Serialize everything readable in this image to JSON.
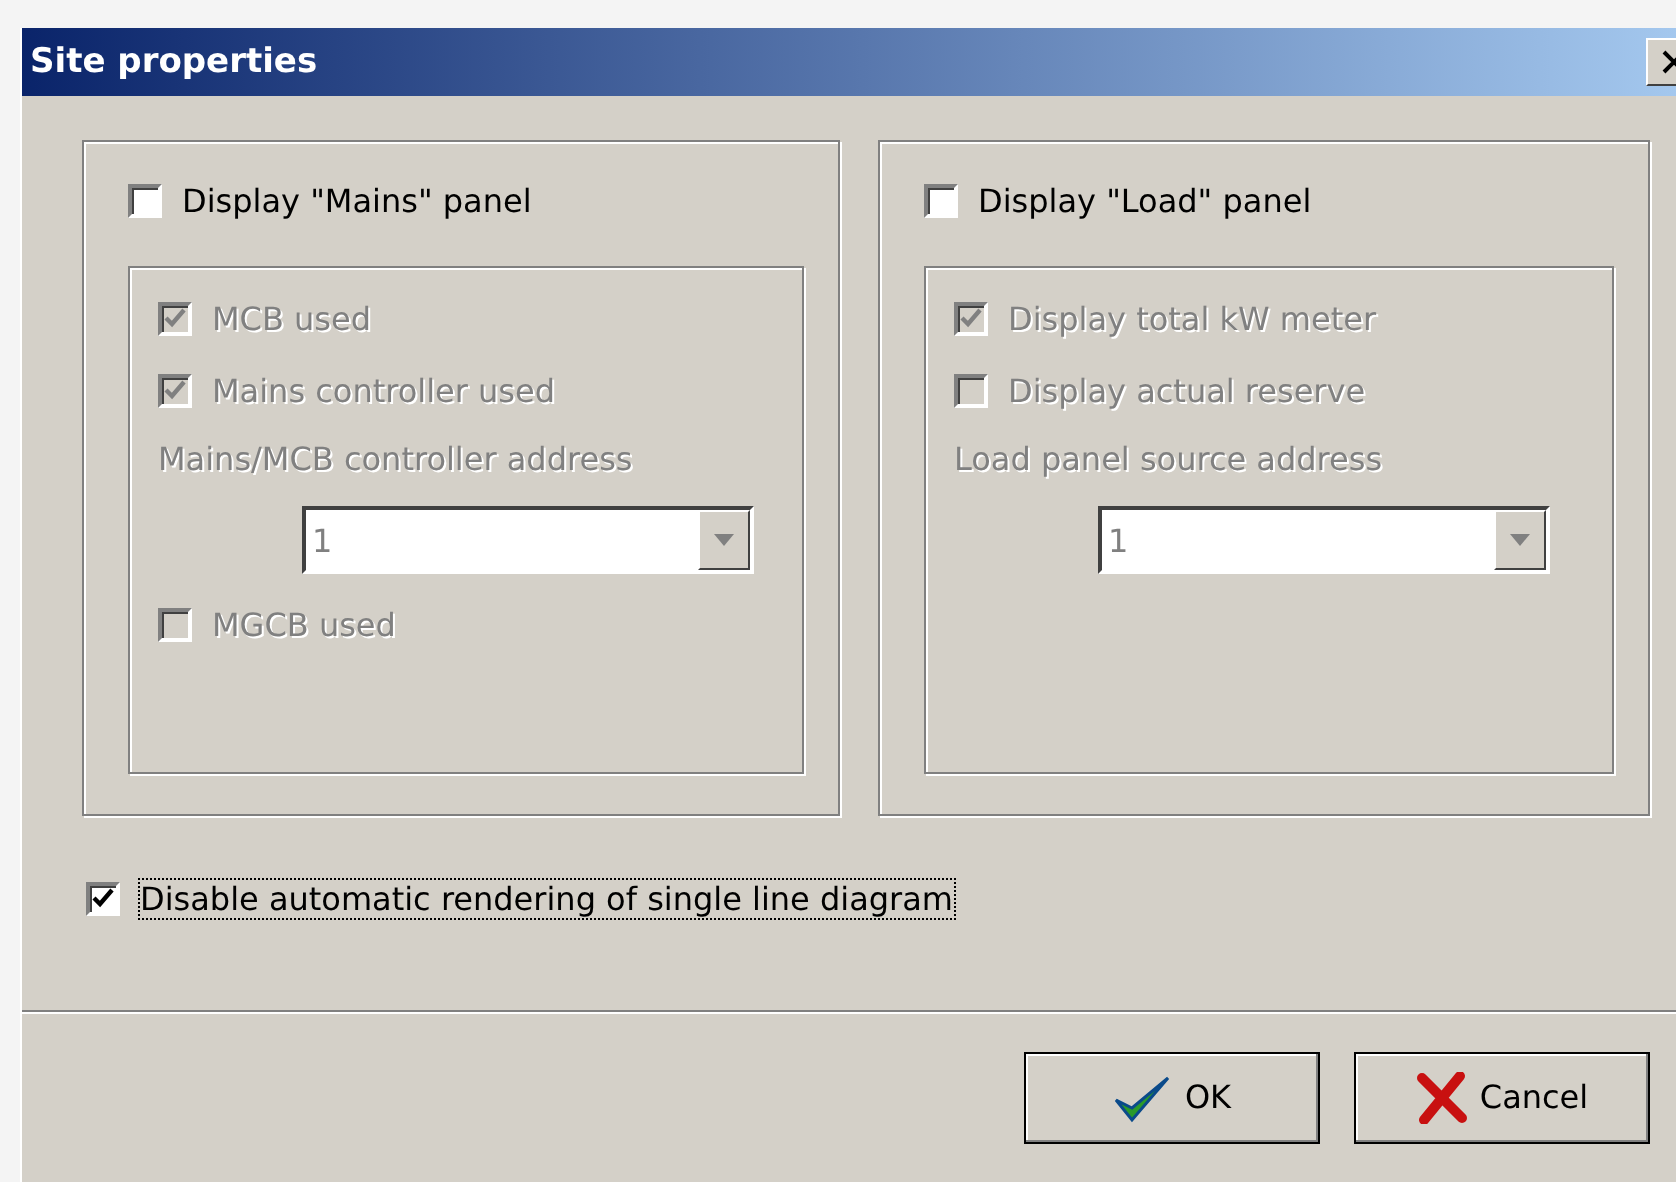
{
  "window": {
    "title": "Site properties"
  },
  "panels": [
    {
      "checkbox": {
        "label": "Display \"Mains\" panel",
        "checked": false
      },
      "options": [
        {
          "kind": "checkbox",
          "label": "MCB used",
          "checked": true,
          "disabled": true
        },
        {
          "kind": "checkbox",
          "label": "Mains controller used",
          "checked": true,
          "disabled": true
        },
        {
          "kind": "select",
          "label": "Mains/MCB controller address",
          "value": "1",
          "disabled": true
        },
        {
          "kind": "checkbox",
          "label": "MGCB used",
          "checked": false,
          "disabled": true
        }
      ]
    },
    {
      "checkbox": {
        "label": "Display \"Load\" panel",
        "checked": false
      },
      "options": [
        {
          "kind": "checkbox",
          "label": "Display total kW meter",
          "checked": true,
          "disabled": true
        },
        {
          "kind": "checkbox",
          "label": "Display actual reserve",
          "checked": false,
          "disabled": true
        },
        {
          "kind": "select",
          "label": "Load panel source address",
          "value": "1",
          "disabled": true
        }
      ]
    }
  ],
  "option": {
    "label": "Disable automatic rendering of single line diagram",
    "checked": true,
    "focused": true
  },
  "buttons": [
    {
      "kind": "ok",
      "label": "OK"
    },
    {
      "kind": "cancel",
      "label": "Cancel"
    }
  ]
}
